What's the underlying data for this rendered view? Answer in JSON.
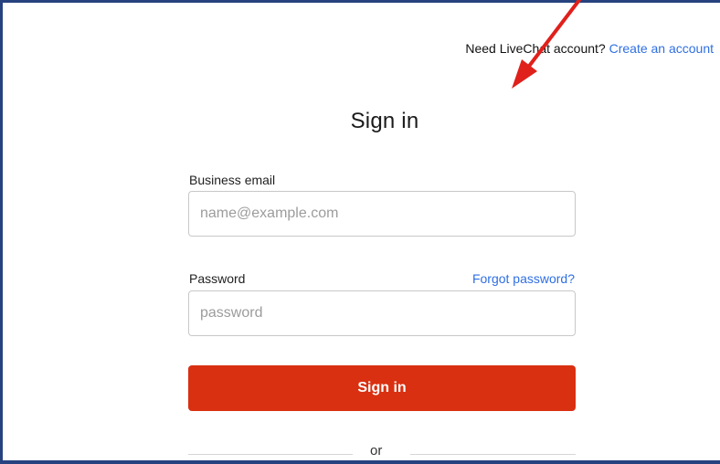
{
  "header": {
    "prompt_text": "Need LiveChat account?",
    "create_account_link": "Create an account"
  },
  "form": {
    "title": "Sign in",
    "email": {
      "label": "Business email",
      "placeholder": "name@example.com"
    },
    "password": {
      "label": "Password",
      "placeholder": "password",
      "forgot_link": "Forgot password?"
    },
    "submit_label": "Sign in",
    "divider_text": "or"
  },
  "colors": {
    "accent": "#d93011",
    "link": "#2f6fe3",
    "annotation": "#e0201b",
    "frame_border": "#26427f"
  },
  "annotation": {
    "icon": "red-arrow-icon"
  }
}
